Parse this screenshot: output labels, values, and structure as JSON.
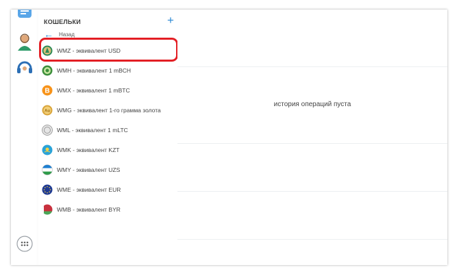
{
  "panel": {
    "title": "КОШЕЛЬКИ",
    "add_label": "+",
    "back_label": "Назад"
  },
  "wallets": [
    {
      "label": "WMZ - эквивалент USD",
      "icon": "wmz-coin-icon",
      "color": "#2e8b57",
      "selected": true
    },
    {
      "label": "WMH - эквивалент 1 mBCH",
      "icon": "wmh-coin-icon",
      "color": "#3c8f3c"
    },
    {
      "label": "WMX - эквивалент 1 mBTC",
      "icon": "wmx-coin-icon",
      "color": "#f7931a"
    },
    {
      "label": "WMG - эквивалент 1-го грамма золота",
      "icon": "wmg-coin-icon",
      "color": "#d9a43a"
    },
    {
      "label": "WML - эквивалент 1 mLTC",
      "icon": "wml-coin-icon",
      "color": "#9a9a9a"
    },
    {
      "label": "WMK - эквивалент KZT",
      "icon": "wmk-coin-icon",
      "color": "#2aa3d8"
    },
    {
      "label": "WMY - эквивалент UZS",
      "icon": "wmy-coin-icon",
      "color": "#1e7fd1"
    },
    {
      "label": "WME - эквивалент EUR",
      "icon": "wme-coin-icon",
      "color": "#1f3a93"
    },
    {
      "label": "WMB - эквивалент BYR",
      "icon": "wmb-coin-icon",
      "color": "#c8313e"
    }
  ],
  "main": {
    "empty_text": "история операций пуста"
  },
  "accent": "#2c89d4",
  "highlight_color": "#e31e24"
}
